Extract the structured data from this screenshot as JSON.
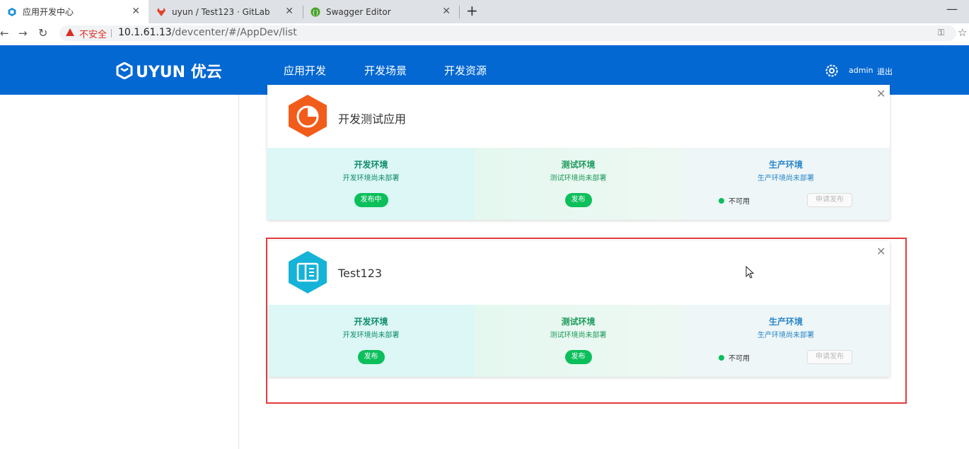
{
  "browser": {
    "tabs": [
      {
        "title": "应用开发中心",
        "icon": "app-tab-icon"
      },
      {
        "title": "uyun / Test123 · GitLab",
        "icon": "gitlab-fox-icon"
      },
      {
        "title": "Swagger Editor",
        "icon": "swagger-icon"
      }
    ],
    "warning_label": "不安全",
    "url_host": "10.1.61.13",
    "url_path": "/devcenter/#/AppDev/list"
  },
  "header": {
    "logo_text": "UYUN 优云",
    "nav": [
      "应用开发",
      "开发场景",
      "开发资源"
    ],
    "user": "admin",
    "logout": "退出"
  },
  "apps": [
    {
      "name": "开发测试应用",
      "icon": "pie-chart-icon",
      "icon_color": "#f25c1a",
      "envs": {
        "dev": {
          "name": "开发环境",
          "desc": "开发环境尚未部署",
          "button": "发布中"
        },
        "test": {
          "name": "测试环境",
          "desc": "测试环境尚未部署",
          "button": "发布"
        },
        "prod": {
          "name": "生产环境",
          "desc": "生产环境尚未部署",
          "status": "不可用",
          "button": "申请发布"
        }
      }
    },
    {
      "name": "Test123",
      "icon": "book-icon",
      "icon_color": "#16b3d8",
      "envs": {
        "dev": {
          "name": "开发环境",
          "desc": "开发环境尚未部署",
          "button": "发布"
        },
        "test": {
          "name": "测试环境",
          "desc": "测试环境尚未部署",
          "button": "发布"
        },
        "prod": {
          "name": "生产环境",
          "desc": "生产环境尚未部署",
          "status": "不可用",
          "button": "申请发布"
        }
      }
    }
  ],
  "colors": {
    "header_bg": "#0468d3",
    "success": "#0bbf5b",
    "highlight": "#e23b3b"
  }
}
